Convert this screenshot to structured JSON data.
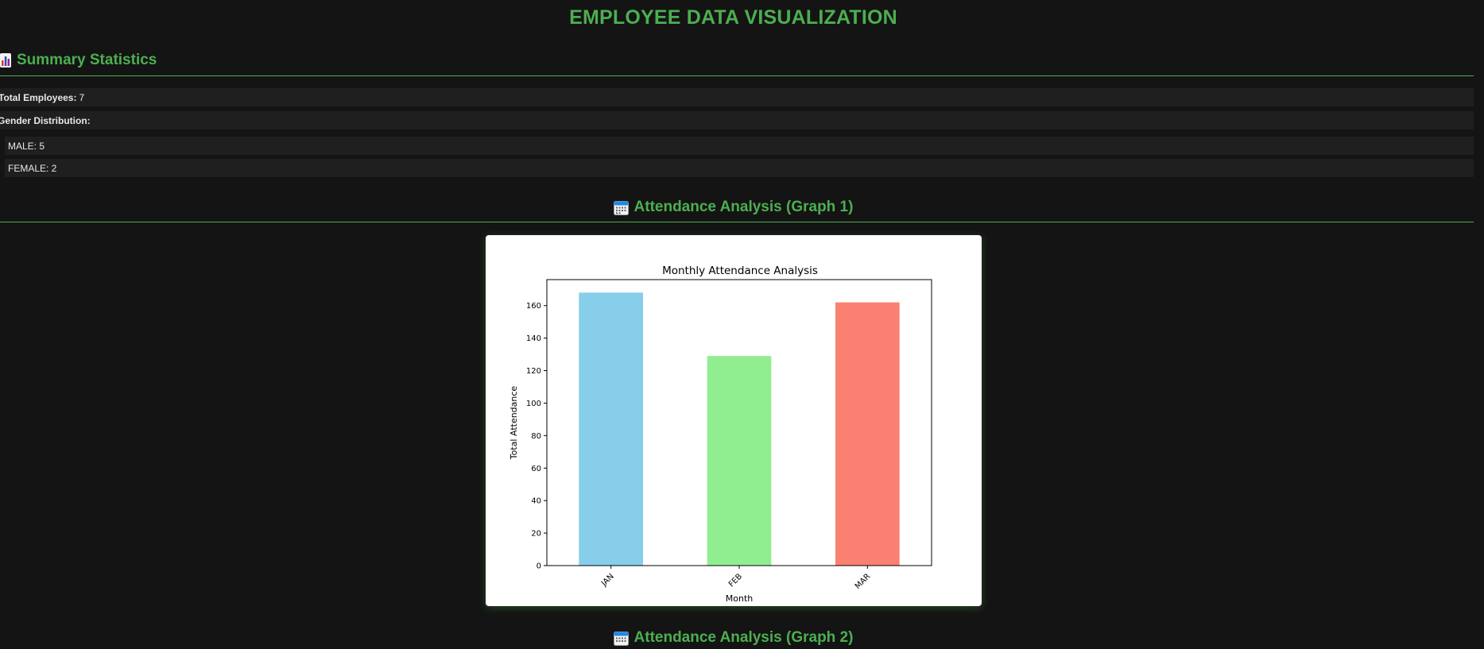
{
  "page": {
    "title": "EMPLOYEE DATA VISUALIZATION"
  },
  "summary": {
    "heading": "Summary Statistics",
    "icon": "bar-chart-icon",
    "total_employees_label": "Total Employees:",
    "total_employees_value": "7",
    "gender_label": "Gender Distribution:",
    "gender_items": [
      "MALE: 5",
      "FEMALE: 2"
    ]
  },
  "graph1": {
    "heading": "Attendance Analysis (Graph 1)",
    "icon": "calendar-icon"
  },
  "graph2": {
    "heading": "Attendance Analysis (Graph 2)",
    "icon": "calendar-icon"
  },
  "colors": {
    "accent": "#4caf50",
    "background": "#141414",
    "row_bg": "#1f1f1f"
  },
  "chart_data": {
    "type": "bar",
    "title": "Monthly Attendance Analysis",
    "xlabel": "Month",
    "ylabel": "Total Attendance",
    "categories": [
      "JAN",
      "FEB",
      "MAR"
    ],
    "values": [
      168,
      129,
      162
    ],
    "colors": [
      "#87ceeb",
      "#90ee90",
      "#fa8072"
    ],
    "ylim": [
      0,
      176
    ],
    "yticks": [
      0,
      20,
      40,
      60,
      80,
      100,
      120,
      140,
      160
    ],
    "grid": false,
    "legend": "none"
  }
}
